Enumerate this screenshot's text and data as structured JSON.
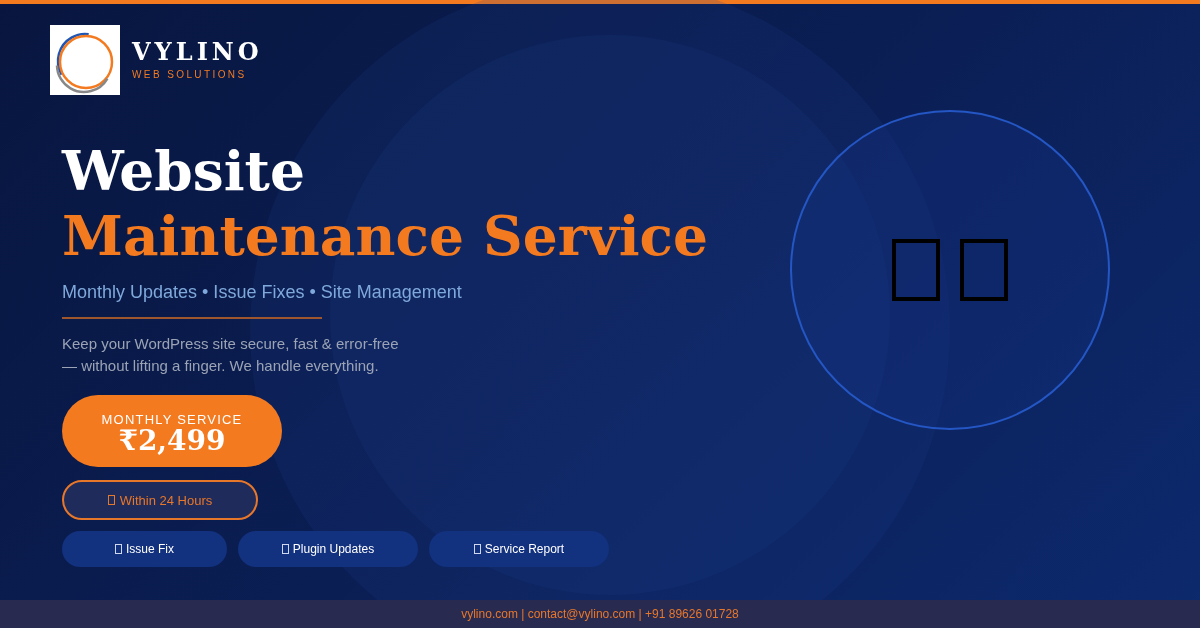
{
  "brand": {
    "name": "VYLINO",
    "tagline": "WEB SOLUTIONS"
  },
  "headline": {
    "line_1": "Website",
    "line_2": "Maintenance Service"
  },
  "subtitle": "Monthly Updates • Issue Fixes • Site Management",
  "description": [
    "Keep your WordPress site secure, fast & error-free",
    "— without lifting a finger. We handle everything."
  ],
  "price": {
    "label": "MONTHLY SERVICE",
    "amount": "₹2,499"
  },
  "turnaround": {
    "label": "Within 24 Hours"
  },
  "features": [
    {
      "label": "Issue Fix"
    },
    {
      "label": "Plugin Updates"
    },
    {
      "label": "Service Report"
    }
  ],
  "footer": "vylino.com | contact@vylino.com | +91 89626 01728"
}
